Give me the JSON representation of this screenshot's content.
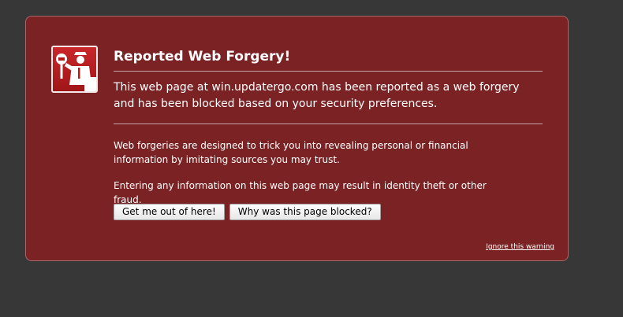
{
  "warning": {
    "icon": "forgery-police-icon",
    "title": "Reported Web Forgery!",
    "lead": "This web page at win.updatergo.com has been reported as a web forgery and has been blocked based on your security preferences.",
    "paragraph_1": "Web forgeries are designed to trick you into revealing personal or financial information by imitating sources you may trust.",
    "paragraph_2": "Entering any information on this web page may result in identity theft or other fraud.",
    "buttons": {
      "get_out": "Get me out of here!",
      "why_blocked": "Why was this page blocked?"
    },
    "ignore_link": "Ignore this warning"
  },
  "colors": {
    "background": "#373737",
    "panel": "#7a2224",
    "icon_red": "#c9262a"
  }
}
